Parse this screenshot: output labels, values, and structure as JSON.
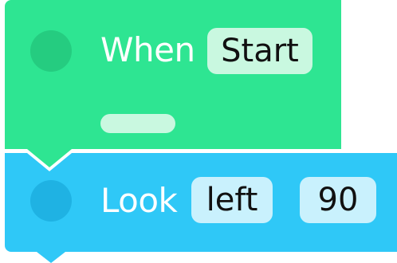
{
  "colors": {
    "event_block": "#2ee592",
    "event_dot": "#25cc80",
    "event_pill": "#c9f8e0",
    "event_slot": "#c9f8e0",
    "action_block": "#2fc8f7",
    "action_dot": "#1fb2e3",
    "action_pill": "#c9f1fd"
  },
  "event_block": {
    "label": "When",
    "trigger_value": "Start",
    "handle_icon": "drag-handle-dot",
    "slot_icon": "empty-slot"
  },
  "action_block": {
    "label": "Look",
    "direction_value": "left",
    "degrees_value": "90",
    "handle_icon": "drag-handle-dot"
  }
}
